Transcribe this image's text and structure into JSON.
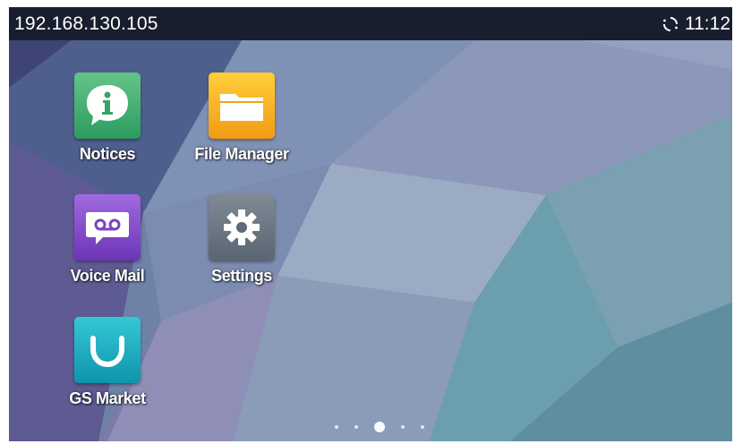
{
  "status_bar": {
    "ip_address": "192.168.130.105",
    "sync_icon": "sync-icon",
    "time": "11:12"
  },
  "apps": [
    {
      "label": "Notices",
      "icon": "info-icon",
      "color": "#3fac6f"
    },
    {
      "label": "File Manager",
      "icon": "folder-icon",
      "color": "#f6b326"
    },
    {
      "label": "Voice Mail",
      "icon": "voicemail-icon",
      "color": "#8a53d0"
    },
    {
      "label": "Settings",
      "icon": "gear-icon",
      "color": "#68737f"
    },
    {
      "label": "GS Market",
      "icon": "market-icon",
      "color": "#1fb0c4"
    }
  ],
  "pager": {
    "page_count": 5,
    "current_page": 3
  }
}
